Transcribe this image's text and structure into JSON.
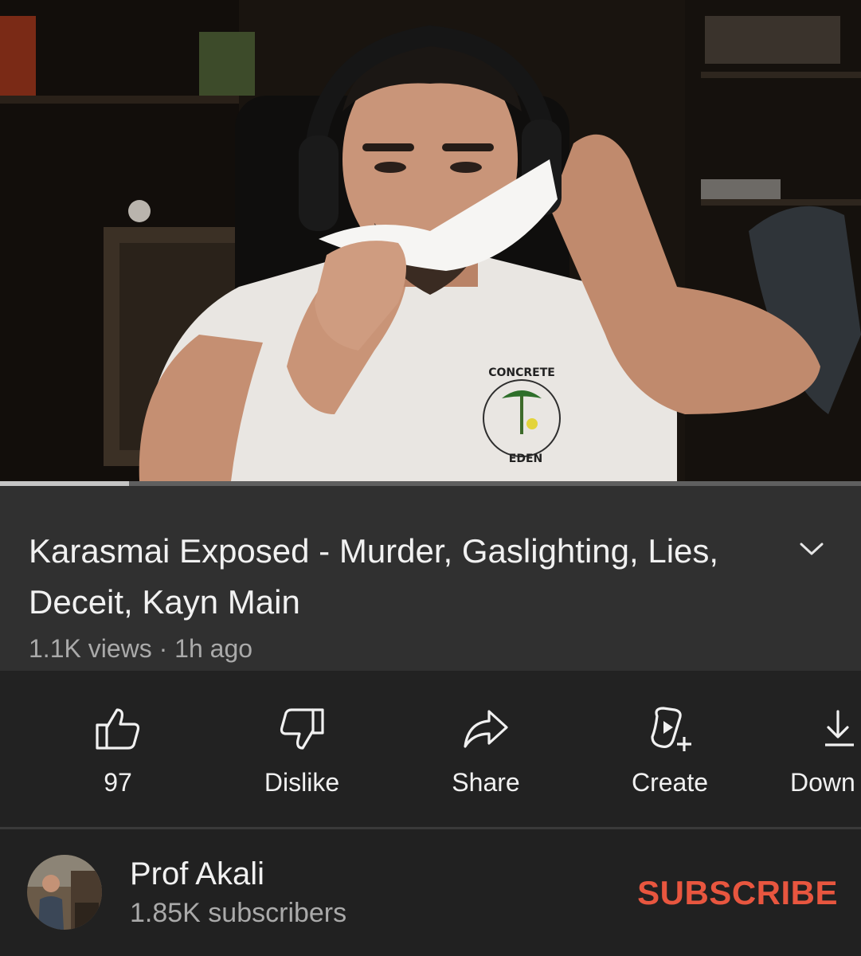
{
  "video": {
    "thumbnail": "person-with-headset-holding-paper",
    "shirt_text": [
      "CONCRETE",
      "EDEN"
    ],
    "progress_fraction": 0.15
  },
  "info": {
    "title": "Karasmai Exposed - Murder, Gaslighting, Lies, Deceit, Kayn Main",
    "meta": "1.1K views · 1h ago",
    "expand_icon": "chevron-down-icon"
  },
  "actions": [
    {
      "icon": "thumbs-up-icon",
      "label": "97"
    },
    {
      "icon": "thumbs-down-icon",
      "label": "Dislike"
    },
    {
      "icon": "share-icon",
      "label": "Share"
    },
    {
      "icon": "create-icon",
      "label": "Create"
    },
    {
      "icon": "download-icon",
      "label": "Down"
    }
  ],
  "channel": {
    "name": "Prof Akali",
    "subscribers": "1.85K subscribers",
    "subscribe_label": "SUBSCRIBE",
    "subscribe_color": "#e8563f"
  }
}
